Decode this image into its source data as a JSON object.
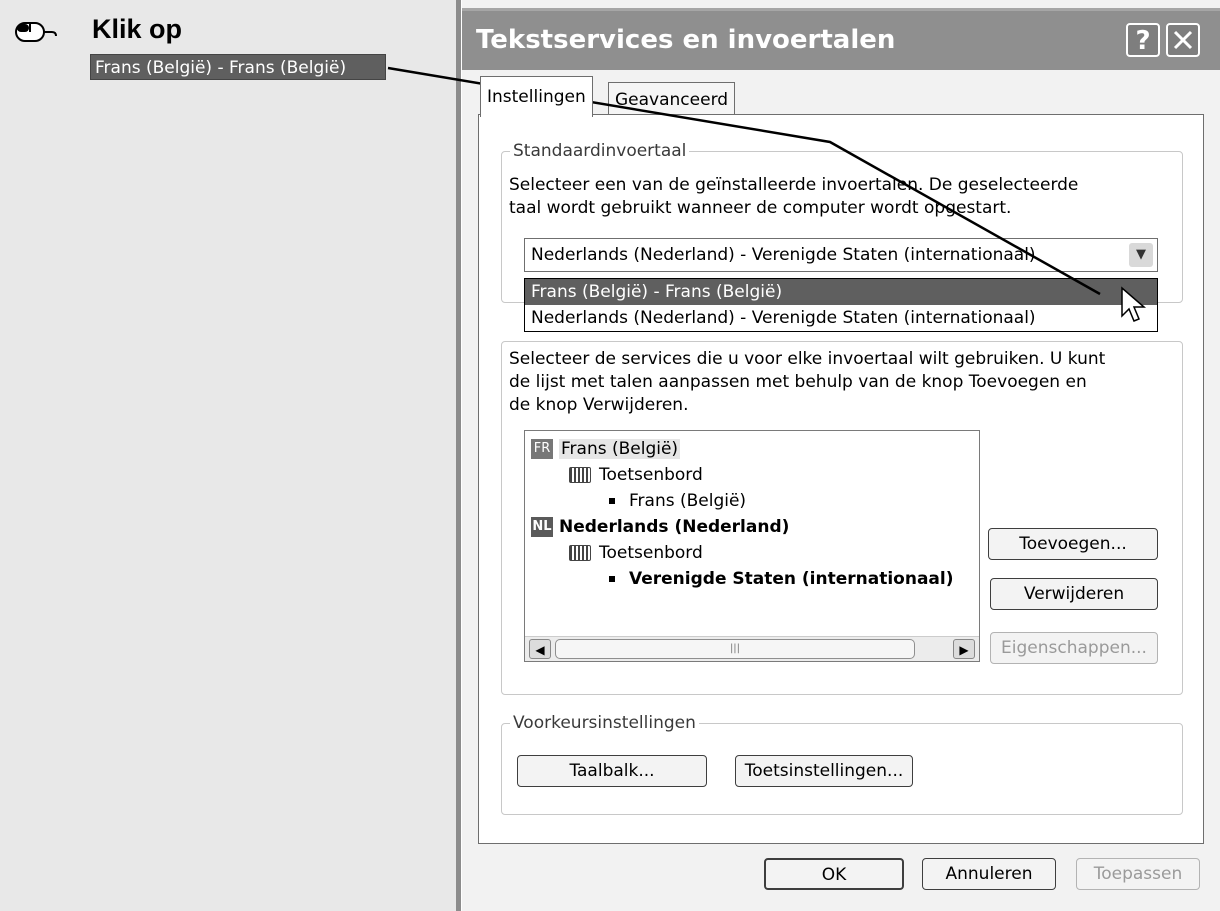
{
  "instruction": {
    "title": "Klik op",
    "target_item": "Frans (België) - Frans (België)"
  },
  "dialog": {
    "title": "Tekstservices en invoertalen",
    "help_label": "?",
    "close_label": "X",
    "tabs": [
      {
        "label": "Instellingen"
      },
      {
        "label": "Geavanceerd"
      }
    ],
    "default_language": {
      "group_label": "Standaardinvoertaal",
      "description": [
        "Selecteer een van de geïnstalleerde invoertalen. De geselecteerde",
        "taal wordt gebruikt wanneer de computer wordt opgestart."
      ],
      "combo_value": "Nederlands (Nederland) - Verenigde Staten (internationaal)",
      "dropdown_options": [
        {
          "label": "Frans (België) - Frans (België)"
        },
        {
          "label": "Nederlands (Nederland) - Verenigde Staten (internationaal)"
        }
      ]
    },
    "installed_services": {
      "description": [
        "Selecteer de services die u voor elke invoertaal wilt gebruiken. U kunt",
        "de lijst met talen aanpassen met behulp van de knop Toevoegen en",
        "de knop Verwijderen."
      ],
      "tree": [
        {
          "badge": "FR",
          "label": "Frans (België)"
        },
        {
          "label": "Toetsenbord"
        },
        {
          "label": "Frans (België)"
        },
        {
          "badge": "NL",
          "label": "Nederlands (Nederland)"
        },
        {
          "label": "Toetsenbord"
        },
        {
          "label": "Verenigde Staten (internationaal)"
        }
      ],
      "add_button": "Toevoegen...",
      "remove_button": "Verwijderen",
      "properties_button": "Eigenschappen..."
    },
    "preferences": {
      "group_label": "Voorkeursinstellingen",
      "language_bar_button": "Taalbalk...",
      "key_settings_button": "Toetsinstellingen..."
    },
    "ok_button": "OK",
    "cancel_button": "Annuleren",
    "apply_button": "Toepassen"
  }
}
